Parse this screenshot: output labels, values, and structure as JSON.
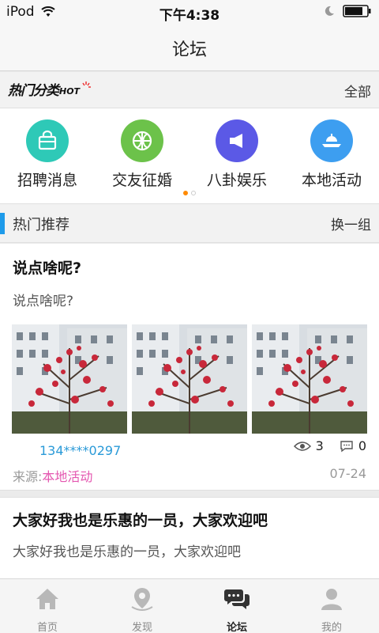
{
  "status_bar": {
    "carrier": "iPod",
    "time": "下午4:38"
  },
  "nav": {
    "title": "论坛"
  },
  "categories_header": {
    "logo_text": "热门分类",
    "logo_hot": "HOT",
    "see_all": "全部"
  },
  "categories": [
    {
      "label": "招聘消息",
      "icon": "bag-icon",
      "color": "#2ec9b7"
    },
    {
      "label": "交友征婚",
      "icon": "ball-icon",
      "color": "#6cc24a"
    },
    {
      "label": "八卦娱乐",
      "icon": "megaphone-icon",
      "color": "#5b59e6"
    },
    {
      "label": "本地活动",
      "icon": "boat-icon",
      "color": "#3d9ef0"
    }
  ],
  "pager": {
    "pages": 2,
    "active": 0
  },
  "recommend": {
    "title": "热门推荐",
    "switch_label": "换一组"
  },
  "posts": [
    {
      "title": "说点啥呢?",
      "desc": "说点啥呢?",
      "author": "134****0297",
      "views": "3",
      "comments": "0",
      "source_label": "来源:",
      "source_value": "本地活动",
      "date": "07-24"
    },
    {
      "title": "大家好我也是乐惠的一员，大家欢迎吧",
      "desc": "大家好我也是乐惠的一员，大家欢迎吧"
    }
  ],
  "tabs": [
    {
      "label": "首页",
      "icon": "home-icon",
      "active": false
    },
    {
      "label": "发现",
      "icon": "location-icon",
      "active": false
    },
    {
      "label": "论坛",
      "icon": "chat-icon",
      "active": true
    },
    {
      "label": "我的",
      "icon": "user-icon",
      "active": false
    }
  ],
  "colors": {
    "accent_blue": "#1e9bea",
    "pager_active": "#ff8a00",
    "source_pink": "#e457b0"
  }
}
